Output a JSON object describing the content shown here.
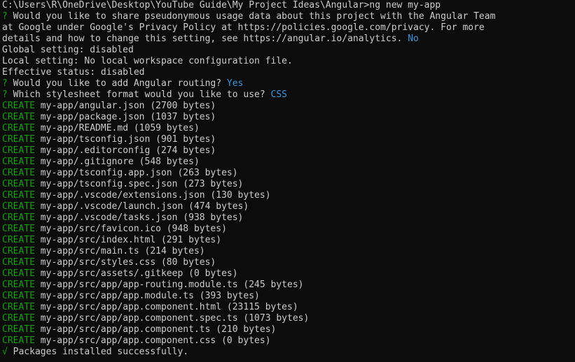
{
  "window": {
    "title": "C:\\Users\\R\\OneDrive\\Desktop\\YouTube Guide\\My Project Ideas\\Angular>ng new my-app"
  },
  "colors": {
    "background": "#0c0c0c",
    "text": "#cccccc",
    "green": "#13a10e",
    "cyan": "#3a96dd"
  },
  "terminal": {
    "command_line": "C:\\Users\\R\\OneDrive\\Desktop\\YouTube Guide\\My Project Ideas\\Angular>ng new my-app",
    "analytics_question": {
      "marker": "?",
      "lines": [
        " Would you like to share pseudonymous usage data about this project with the Angular Team",
        "at Google under Google's Privacy Policy at https://policies.google.com/privacy. For more",
        "details and how to change this setting, see https://angular.io/analytics. "
      ],
      "answer": "No"
    },
    "status_lines": [
      "Global setting: disabled",
      "Local setting: No local workspace configuration file.",
      "Effective status: disabled"
    ],
    "routing_question": {
      "marker": "?",
      "text": " Would you like to add Angular routing? ",
      "answer": "Yes"
    },
    "stylesheet_question": {
      "marker": "?",
      "text": " Which stylesheet format would you like to use? ",
      "answer": "CSS"
    },
    "create_label": "CREATE",
    "created_files": [
      " my-app/angular.json (2700 bytes)",
      " my-app/package.json (1037 bytes)",
      " my-app/README.md (1059 bytes)",
      " my-app/tsconfig.json (901 bytes)",
      " my-app/.editorconfig (274 bytes)",
      " my-app/.gitignore (548 bytes)",
      " my-app/tsconfig.app.json (263 bytes)",
      " my-app/tsconfig.spec.json (273 bytes)",
      " my-app/.vscode/extensions.json (130 bytes)",
      " my-app/.vscode/launch.json (474 bytes)",
      " my-app/.vscode/tasks.json (938 bytes)",
      " my-app/src/favicon.ico (948 bytes)",
      " my-app/src/index.html (291 bytes)",
      " my-app/src/main.ts (214 bytes)",
      " my-app/src/styles.css (80 bytes)",
      " my-app/src/assets/.gitkeep (0 bytes)",
      " my-app/src/app/app-routing.module.ts (245 bytes)",
      " my-app/src/app/app.module.ts (393 bytes)",
      " my-app/src/app/app.component.html (23115 bytes)",
      " my-app/src/app/app.component.spec.ts (1073 bytes)",
      " my-app/src/app/app.component.ts (210 bytes)",
      " my-app/src/app/app.component.css (0 bytes)"
    ],
    "success": {
      "marker": "√",
      "text": " Packages installed successfully."
    }
  }
}
